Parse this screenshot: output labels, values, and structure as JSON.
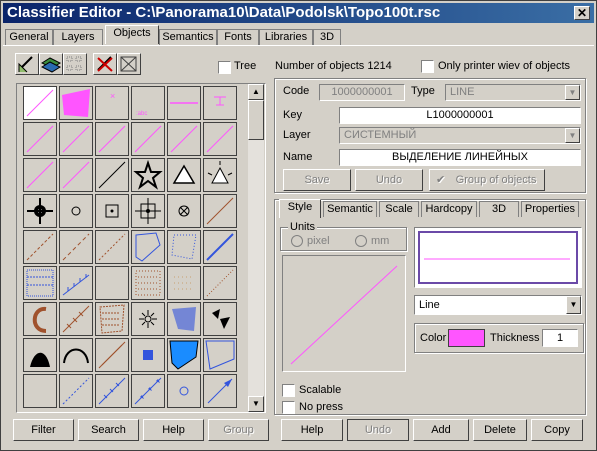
{
  "window": {
    "title": "Classifier Editor - C:\\Panorama10\\Data\\Podolsk\\Topo100t.rsc",
    "close_glyph": "✕"
  },
  "tabs": [
    {
      "label": "General"
    },
    {
      "label": "Layers"
    },
    {
      "label": "Objects"
    },
    {
      "label": "Semantics"
    },
    {
      "label": "Fonts"
    },
    {
      "label": "Libraries"
    },
    {
      "label": "3D"
    }
  ],
  "left": {
    "tree_label": "Tree",
    "buttons": {
      "filter": "Filter",
      "search": "Search",
      "help": "Help",
      "group": "Group"
    }
  },
  "header": {
    "objects_count_label": "Number of objects 1214",
    "only_printer_label": "Only printer wiev of objects"
  },
  "props": {
    "code_label": "Code",
    "code_value": "1000000001",
    "type_label": "Type",
    "type_value": "LINE",
    "key_label": "Key",
    "key_value": "L1000000001",
    "layer_label": "Layer",
    "layer_value": "СИСТЕМНЫЙ",
    "name_label": "Name",
    "name_value": "ВЫДЕЛЕНИЕ ЛИНЕЙНЫХ",
    "save": "Save",
    "undo": "Undo",
    "group_of_objects": "Group of objects"
  },
  "style_tabs": [
    {
      "label": "Style"
    },
    {
      "label": "Semantic"
    },
    {
      "label": "Scale"
    },
    {
      "label": "Hardcopy"
    },
    {
      "label": "3D"
    },
    {
      "label": "Properties"
    }
  ],
  "style": {
    "units_label": "Units",
    "pixel": "pixel",
    "mm": "mm",
    "line_select": "Line",
    "color_label": "Color",
    "color_value": "#ff55ff",
    "thickness_label": "Thickness",
    "thickness_value": "1",
    "scalable": "Scalable",
    "no_press": "No press"
  },
  "bottom_buttons": {
    "help": "Help",
    "undo": "Undo",
    "add": "Add",
    "delete": "Delete",
    "copy": "Copy"
  }
}
